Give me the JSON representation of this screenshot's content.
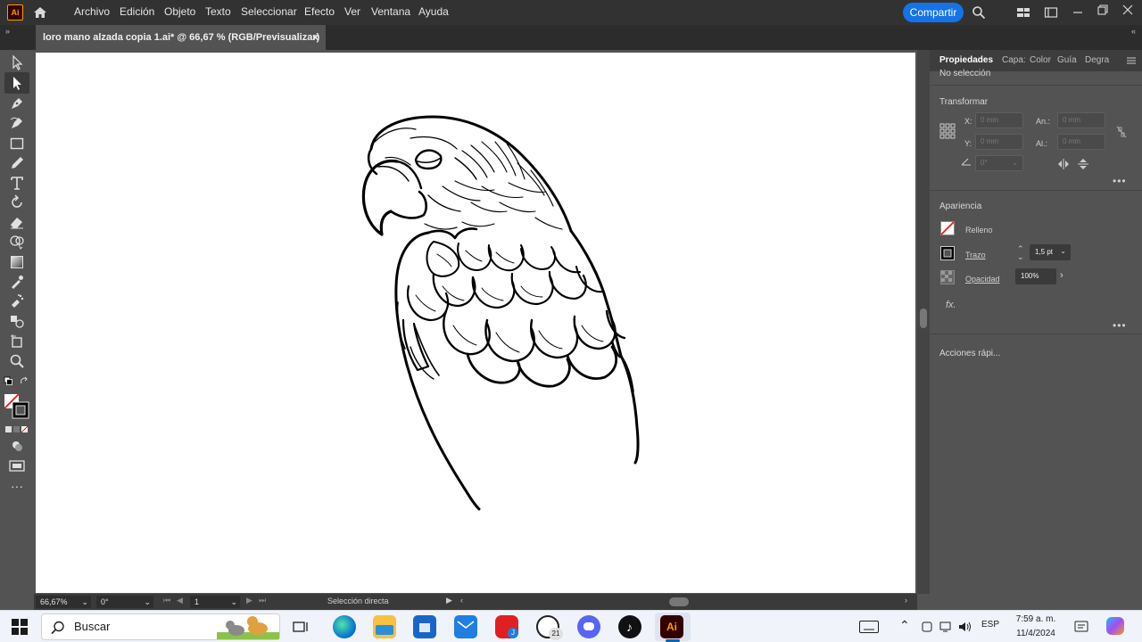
{
  "app": {
    "logo": "Ai"
  },
  "menu": [
    "Archivo",
    "Edición",
    "Objeto",
    "Texto",
    "Seleccionar",
    "Efecto",
    "Ver",
    "Ventana",
    "Ayuda"
  ],
  "share_label": "Compartir",
  "document_tab": {
    "title": "loro mano alzada copia 1.ai* @ 66,67 % (RGB/Previsualizar)",
    "close": "×"
  },
  "panel": {
    "tabs": [
      "Propiedades",
      "Capa:",
      "Color",
      "Guía",
      "Degra"
    ],
    "selection_status": "No selección",
    "transform": {
      "title": "Transformar",
      "x_label": "X:",
      "x_value": "0 mm",
      "y_label": "Y:",
      "y_value": "0 mm",
      "w_label": "An.:",
      "w_value": "0 mm",
      "h_label": "Al.:",
      "h_value": "0 mm",
      "angle_value": "0°"
    },
    "appearance": {
      "title": "Apariencia",
      "fill_label": "Relleno",
      "stroke_label": "Trazo",
      "stroke_value": "1,5 pt",
      "opacity_label": "Opacidad",
      "opacity_value": "100%",
      "fx_label": "fx."
    },
    "quick_actions": "Acciones rápi..."
  },
  "status": {
    "zoom": "66,67%",
    "rotation": "0°",
    "artboard": "1",
    "tool": "Selección directa"
  },
  "taskbar": {
    "search_placeholder": "Buscar",
    "whatsapp_badge": "21",
    "language": "ESP",
    "time": "7:59 a. m.",
    "date": "11/4/2024",
    "adobe_label": "Ai"
  },
  "colors": {
    "accent": "#1473e6",
    "ui_dark": "#323232",
    "panel": "#535353",
    "illustrator_orange": "#ff9a00"
  }
}
